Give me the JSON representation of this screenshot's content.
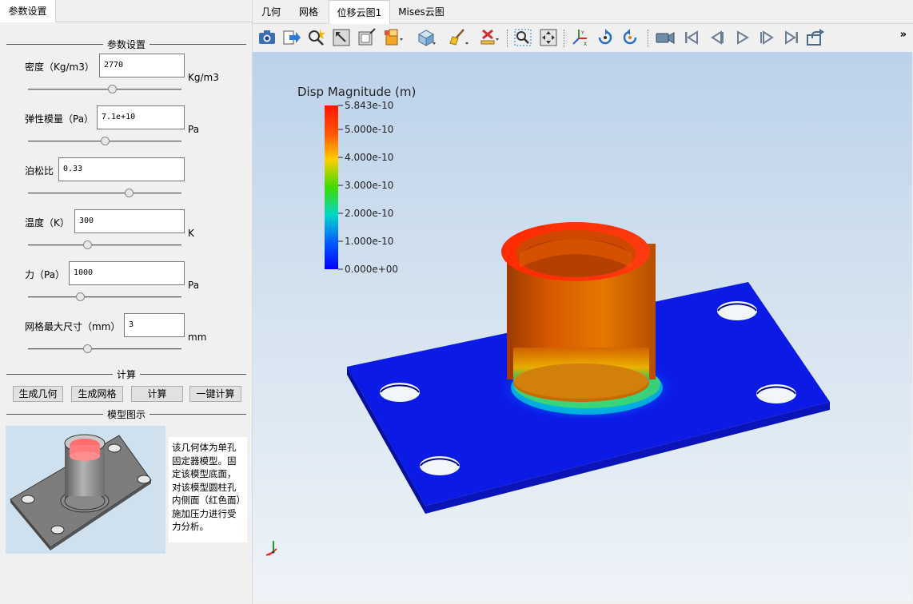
{
  "left_panel": {
    "tab_label": "参数设置",
    "group_params_title": "参数设置",
    "params": [
      {
        "label": "密度（Kg/m3）",
        "value": "2770",
        "unit": "Kg/m3",
        "slider_fraction": 0.55
      },
      {
        "label": "弹性模量（Pa）",
        "value": "7.1e+10",
        "unit": "Pa",
        "slider_fraction": 0.5
      },
      {
        "label": "泊松比",
        "value": "0.33",
        "unit": "",
        "slider_fraction": 0.67
      },
      {
        "label": "温度（K）",
        "value": "300",
        "unit": "K",
        "slider_fraction": 0.38
      },
      {
        "label": "力（Pa）",
        "value": "1000",
        "unit": "Pa",
        "slider_fraction": 0.33
      },
      {
        "label": "网格最大尺寸（mm）",
        "value": "3",
        "unit": "mm",
        "slider_fraction": 0.38
      }
    ],
    "group_compute_title": "计算",
    "buttons": {
      "gen_geometry": "生成几何",
      "gen_mesh": "生成网格",
      "compute": "计算",
      "one_click": "一键计算"
    },
    "group_model_title": "模型图示",
    "model_description": "该几何体为单孔固定器模型。固定该模型底面，对该模型圆柱孔内侧面（红色面）施加压力进行受力分析。"
  },
  "tabs": [
    {
      "label": "几何",
      "active": false
    },
    {
      "label": "网格",
      "active": false
    },
    {
      "label": "位移云图1",
      "active": true
    },
    {
      "label": "Mises云图",
      "active": false
    }
  ],
  "toolbar_icons": [
    "camera-icon",
    "export-icon",
    "zoom-pick-icon",
    "reset-view-icon",
    "frame-icon",
    "box-select-icon",
    "cube-icon",
    "clear-brush-icon",
    "delete-icon",
    "zoom-box-icon",
    "fit-icon",
    "axes-icon",
    "rotate-left-icon",
    "rotate-right-icon",
    "video-icon",
    "first-frame-icon",
    "prev-frame-icon",
    "play-icon",
    "next-frame-icon",
    "last-frame-icon",
    "share-icon"
  ],
  "toolbar_more": "»",
  "colorbar": {
    "title": "Disp Magnitude (m)",
    "labels": [
      "5.843e-10",
      "5.000e-10",
      "4.000e-10",
      "3.000e-10",
      "2.000e-10",
      "1.000e-10",
      "0.000e+00"
    ],
    "colors": [
      "#ff1a00",
      "#ff6a00",
      "#ffd200",
      "#00e000",
      "#00e0e0",
      "#0000ff"
    ]
  }
}
